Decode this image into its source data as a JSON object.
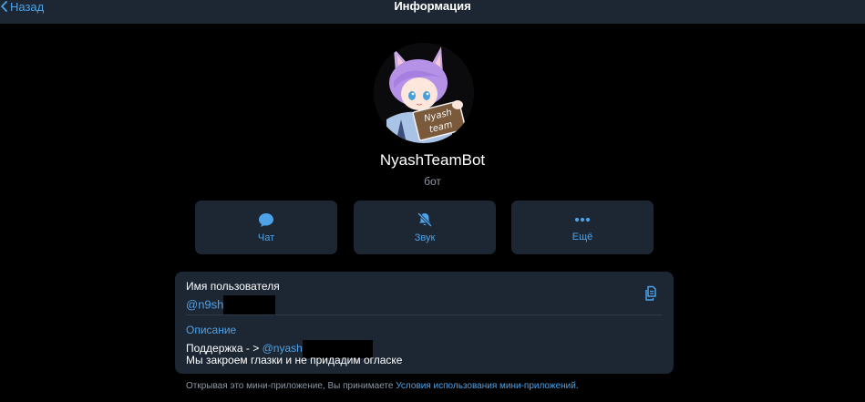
{
  "header": {
    "back_label": "Назад",
    "title": "Информация"
  },
  "profile": {
    "avatar_sign_text": "Nyash team",
    "name": "NyashTeamBot",
    "subtitle": "бот"
  },
  "actions": [
    {
      "label": "Чат",
      "icon": "chat-bubble-icon"
    },
    {
      "label": "Звук",
      "icon": "bell-muted-icon"
    },
    {
      "label": "Ещё",
      "icon": "more-dots-icon"
    }
  ],
  "info": {
    "username_label": "Имя пользователя",
    "username_value": "@n9sh",
    "description_label": "Описание",
    "description_prefix": "Поддержка - > ",
    "description_mention": "@nyash",
    "description_line2": "Мы закроем глазки и не придадим огласке"
  },
  "footer": {
    "text": "Открывая это мини-приложение, Вы принимаете ",
    "link": "Условия использования мини-приложений",
    "end": "."
  },
  "colors": {
    "background": "#000000",
    "card": "#1c2733",
    "accent": "#4da2e8",
    "secondary_text": "#8b98a5"
  }
}
